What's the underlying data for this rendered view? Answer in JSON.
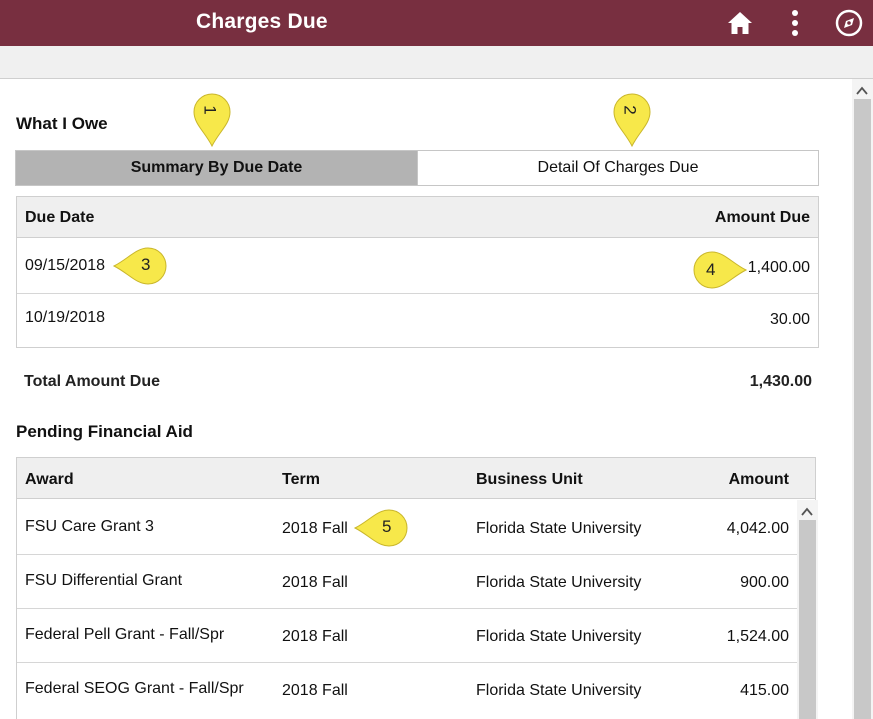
{
  "header": {
    "title": "Charges Due"
  },
  "what_i_owe": {
    "title": "What I Owe",
    "tabs": [
      {
        "label": "Summary By Due Date"
      },
      {
        "label": "Detail Of Charges Due"
      }
    ],
    "columns": {
      "due_date": "Due Date",
      "amount_due": "Amount Due"
    },
    "rows": [
      {
        "due_date": "09/15/2018",
        "amount": "1,400.00"
      },
      {
        "due_date": "10/19/2018",
        "amount": "30.00"
      }
    ],
    "total_label": "Total Amount Due",
    "total_value": "1,430.00"
  },
  "pending_aid": {
    "title": "Pending Financial Aid",
    "columns": {
      "award": "Award",
      "term": "Term",
      "business_unit": "Business Unit",
      "amount": "Amount"
    },
    "rows": [
      {
        "award": "FSU Care Grant 3",
        "term": "2018 Fall",
        "business_unit": "Florida State University",
        "amount": "4,042.00"
      },
      {
        "award": "FSU Differential Grant",
        "term": "2018 Fall",
        "business_unit": "Florida State University",
        "amount": "900.00"
      },
      {
        "award": "Federal Pell Grant - Fall/Spr",
        "term": "2018 Fall",
        "business_unit": "Florida State University",
        "amount": "1,524.00"
      },
      {
        "award": "Federal SEOG Grant - Fall/Spr",
        "term": "2018 Fall",
        "business_unit": "Florida State University",
        "amount": "415.00"
      }
    ]
  },
  "callouts": [
    "1",
    "2",
    "3",
    "4",
    "5"
  ],
  "icons": {
    "home": "home-icon",
    "menu": "vertical-ellipsis-icon",
    "nav": "compass-icon"
  },
  "colors": {
    "header_bg": "#782f40",
    "callout_fill": "#f7e84a",
    "tab_active_bg": "#b3b3b3"
  }
}
